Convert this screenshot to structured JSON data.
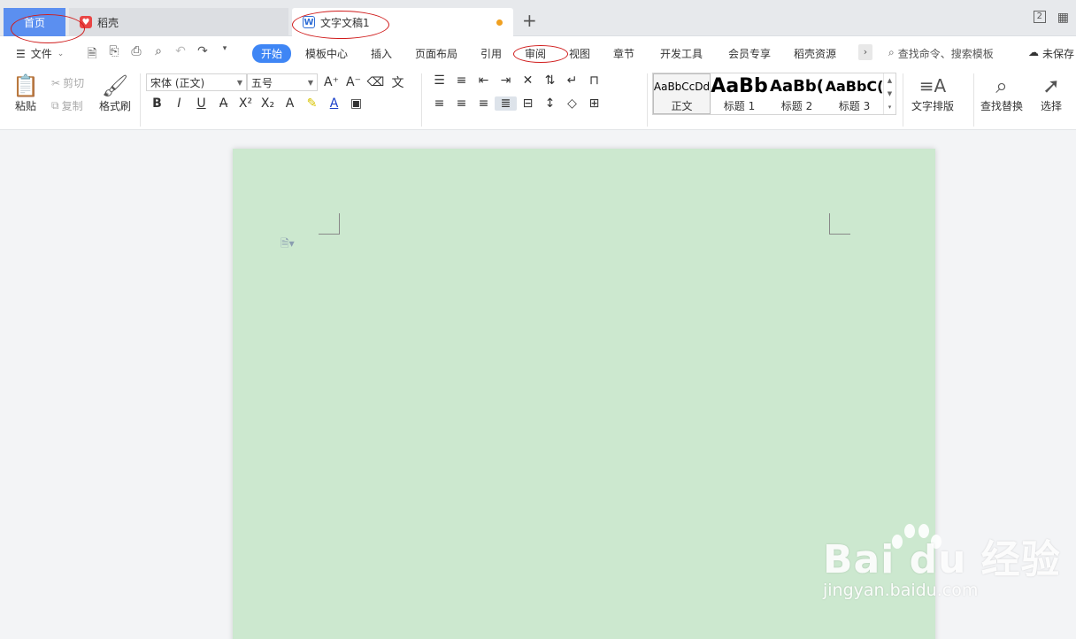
{
  "tabs": {
    "home": "首页",
    "daoke": "稻壳",
    "doc": "文字文稿1",
    "add": "+"
  },
  "window": {
    "count": "2"
  },
  "menu": {
    "file": "文件",
    "start": "开始",
    "items": [
      "模板中心",
      "插入",
      "页面布局",
      "引用",
      "审阅",
      "视图",
      "章节",
      "开发工具",
      "会员专享",
      "稻壳资源"
    ],
    "search": "查找命令、搜索模板",
    "unsaved": "未保存"
  },
  "ribbon": {
    "paste": "粘贴",
    "cut": "剪切",
    "copy": "复制",
    "format_painter": "格式刷",
    "font_name": "宋体 (正文)",
    "font_size": "五号",
    "styles": [
      {
        "preview": "AaBbCcDd",
        "name": "正文"
      },
      {
        "preview": "AaBb",
        "name": "标题 1"
      },
      {
        "preview": "AaBb(",
        "name": "标题 2"
      },
      {
        "preview": "AaBbC(",
        "name": "标题 3"
      }
    ],
    "text_layout": "文字排版",
    "find_replace": "查找替换",
    "select": "选择"
  },
  "watermark": {
    "main": "Bai du 经验",
    "sub": "jingyan.baidu.com"
  },
  "colors": {
    "accent": "#3f86f5",
    "page_bg": "#cce8cf",
    "home_tab": "#5b8ff0",
    "annotation": "#d01c1c"
  }
}
